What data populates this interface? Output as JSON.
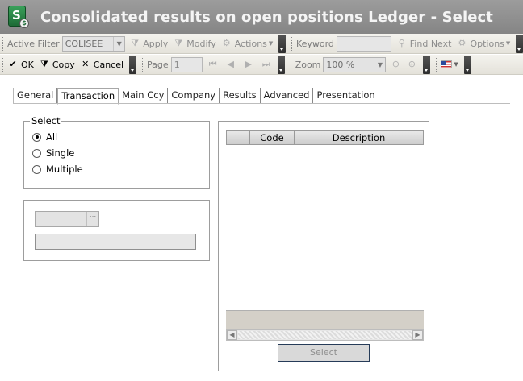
{
  "window": {
    "title": "Consolidated results on open positions Ledger - Select"
  },
  "toolbar1": {
    "active_filter_label": "Active Filter",
    "active_filter_value": "COLISEE",
    "apply_label": "Apply",
    "modify_label": "Modify",
    "actions_label": "Actions",
    "keyword_label": "Keyword",
    "keyword_value": "",
    "find_next_label": "Find Next",
    "options_label": "Options"
  },
  "toolbar2": {
    "ok_label": "OK",
    "copy_label": "Copy",
    "cancel_label": "Cancel",
    "page_label": "Page",
    "page_value": "1",
    "zoom_label": "Zoom",
    "zoom_value": "100 %"
  },
  "tabs": [
    {
      "label": "General"
    },
    {
      "label": "Transaction"
    },
    {
      "label": "Main Ccy"
    },
    {
      "label": "Company"
    },
    {
      "label": "Results"
    },
    {
      "label": "Advanced"
    },
    {
      "label": "Presentation"
    }
  ],
  "select_group": {
    "title": "Select",
    "options": [
      "All",
      "Single",
      "Multiple"
    ],
    "selected": "All"
  },
  "grid": {
    "columns": [
      "",
      "Code",
      "Description"
    ],
    "select_button": "Select"
  },
  "colors": {
    "titlebar": "#8f8f8f",
    "title_text": "#f4f4f4",
    "toolbar": "#ebe9e2",
    "grid_footer": "#d4d0c8"
  }
}
